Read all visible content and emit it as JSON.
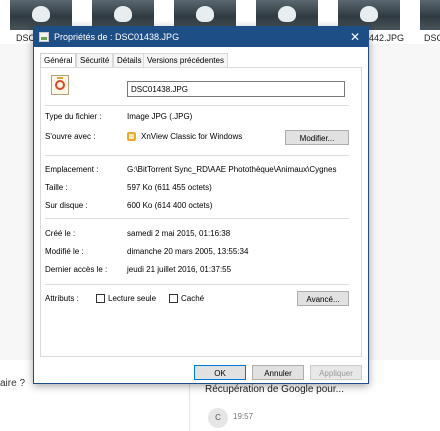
{
  "background": {
    "thumb_labels": [
      "DSC",
      "442.JPG",
      "DSC"
    ],
    "question_fragment": "aire ?",
    "message": "Récupération de Google pour...",
    "avatar": "C",
    "time": "19:57"
  },
  "dialog": {
    "title": "Propriétés de : DSC01438.JPG",
    "close": "✕",
    "tabs": [
      "Général",
      "Sécurité",
      "Détails",
      "Versions précédentes"
    ],
    "filename": "DSC01438.JPG",
    "file_type": {
      "label": "Type du fichier :",
      "value": "Image JPG (.JPG)"
    },
    "opens_with": {
      "label": "S'ouvre avec :",
      "value": "XnView Classic for Windows",
      "button": "Modifier..."
    },
    "location": {
      "label": "Emplacement :",
      "value": "G:\\BitTorrent Sync_RD\\AAE Photothèque\\Animaux\\Cygnes"
    },
    "size": {
      "label": "Taille :",
      "value": "597 Ko (611 455 octets)"
    },
    "size_on_disk": {
      "label": "Sur disque :",
      "value": "600 Ko (614 400 octets)"
    },
    "created": {
      "label": "Créé le :",
      "value": "samedi 2 mai 2015, 01:16:38"
    },
    "modified": {
      "label": "Modifié le :",
      "value": "dimanche 20 mars 2005, 13:55:34"
    },
    "accessed": {
      "label": "Dernier accès le :",
      "value": "jeudi 21 juillet 2016, 01:37:55"
    },
    "attributes": {
      "label": "Attributs :",
      "readonly": "Lecture seule",
      "hidden": "Caché",
      "advanced": "Avancé..."
    },
    "buttons": {
      "ok": "OK",
      "cancel": "Annuler",
      "apply": "Appliquer"
    }
  },
  "colors": {
    "titlebar": "#1d4f86",
    "accent": "#0078d7"
  }
}
